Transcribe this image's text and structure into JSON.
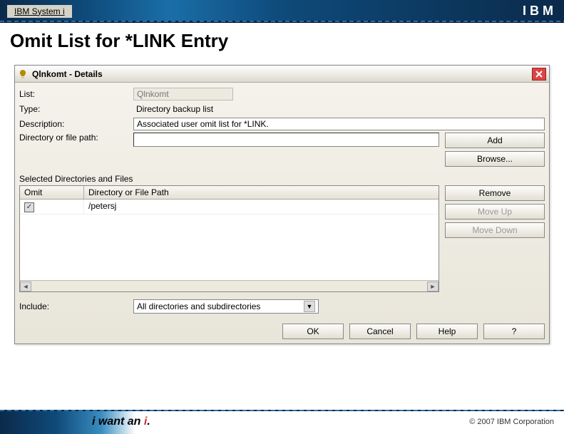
{
  "header": {
    "breadcrumb": "IBM System i",
    "logo_text": "IBM"
  },
  "page_title": "Omit List for *LINK Entry",
  "dialog": {
    "title": "Qlnkomt - Details",
    "list_label": "List:",
    "list_value": "Qlnkomt",
    "type_label": "Type:",
    "type_value": "Directory backup list",
    "desc_label": "Description:",
    "desc_value": "Associated user omit list for *LINK.",
    "path_label": "Directory or file path:",
    "path_value": "",
    "buttons": {
      "add": "Add",
      "browse": "Browse...",
      "remove": "Remove",
      "move_up": "Move Up",
      "move_down": "Move Down",
      "ok": "OK",
      "cancel": "Cancel",
      "help": "Help",
      "q": "?"
    },
    "section_label": "Selected Directories and Files",
    "table": {
      "col_omit": "Omit",
      "col_path": "Directory or File Path",
      "rows": [
        {
          "omit_checked": true,
          "path": "/petersj"
        }
      ]
    },
    "include_label": "Include:",
    "include_value": "All directories and subdirectories"
  },
  "footer": {
    "tagline_prefix": "i want an ",
    "tagline_accent": "i",
    "tagline_suffix": ".",
    "copyright": "© 2007 IBM Corporation"
  }
}
